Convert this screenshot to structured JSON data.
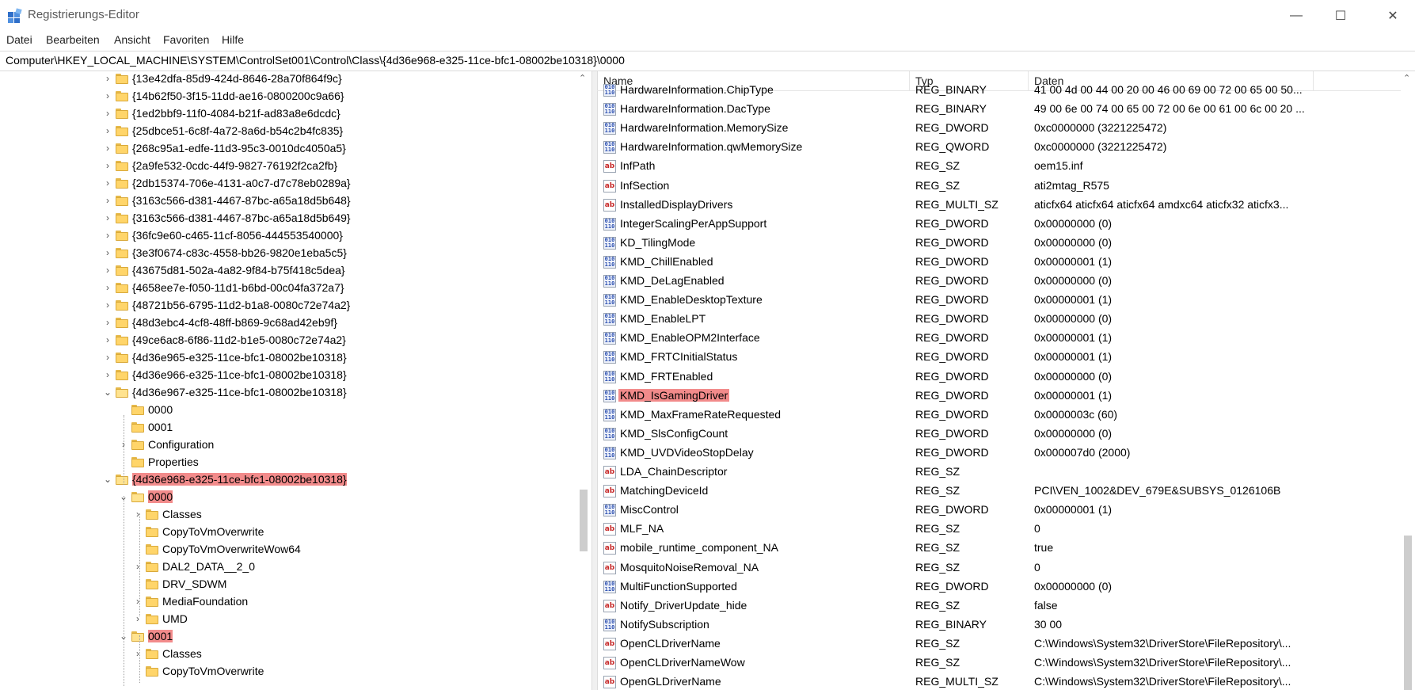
{
  "window": {
    "title": "Registrierungs-Editor",
    "controls": {
      "minimize": "—",
      "maximize": "☐",
      "close": "✕"
    }
  },
  "menu": [
    "Datei",
    "Bearbeiten",
    "Ansicht",
    "Favoriten",
    "Hilfe"
  ],
  "address": "Computer\\HKEY_LOCAL_MACHINE\\SYSTEM\\ControlSet001\\Control\\Class\\{4d36e968-e325-11ce-bfc1-08002be10318}\\0000",
  "tree": [
    {
      "label": "{13e42dfa-85d9-424d-8646-28a70f864f9c}",
      "depth": 0,
      "expander": "collapsed",
      "highlight": false
    },
    {
      "label": "{14b62f50-3f15-11dd-ae16-0800200c9a66}",
      "depth": 0,
      "expander": "collapsed",
      "highlight": false
    },
    {
      "label": "{1ed2bbf9-11f0-4084-b21f-ad83a8e6dcdc}",
      "depth": 0,
      "expander": "collapsed",
      "highlight": false
    },
    {
      "label": "{25dbce51-6c8f-4a72-8a6d-b54c2b4fc835}",
      "depth": 0,
      "expander": "collapsed",
      "highlight": false
    },
    {
      "label": "{268c95a1-edfe-11d3-95c3-0010dc4050a5}",
      "depth": 0,
      "expander": "collapsed",
      "highlight": false
    },
    {
      "label": "{2a9fe532-0cdc-44f9-9827-76192f2ca2fb}",
      "depth": 0,
      "expander": "collapsed",
      "highlight": false
    },
    {
      "label": "{2db15374-706e-4131-a0c7-d7c78eb0289a}",
      "depth": 0,
      "expander": "collapsed",
      "highlight": false
    },
    {
      "label": "{3163c566-d381-4467-87bc-a65a18d5b648}",
      "depth": 0,
      "expander": "collapsed",
      "highlight": false
    },
    {
      "label": "{3163c566-d381-4467-87bc-a65a18d5b649}",
      "depth": 0,
      "expander": "collapsed",
      "highlight": false
    },
    {
      "label": "{36fc9e60-c465-11cf-8056-444553540000}",
      "depth": 0,
      "expander": "collapsed",
      "highlight": false
    },
    {
      "label": "{3e3f0674-c83c-4558-bb26-9820e1eba5c5}",
      "depth": 0,
      "expander": "collapsed",
      "highlight": false
    },
    {
      "label": "{43675d81-502a-4a82-9f84-b75f418c5dea}",
      "depth": 0,
      "expander": "collapsed",
      "highlight": false
    },
    {
      "label": "{4658ee7e-f050-11d1-b6bd-00c04fa372a7}",
      "depth": 0,
      "expander": "collapsed",
      "highlight": false
    },
    {
      "label": "{48721b56-6795-11d2-b1a8-0080c72e74a2}",
      "depth": 0,
      "expander": "collapsed",
      "highlight": false
    },
    {
      "label": "{48d3ebc4-4cf8-48ff-b869-9c68ad42eb9f}",
      "depth": 0,
      "expander": "collapsed",
      "highlight": false
    },
    {
      "label": "{49ce6ac8-6f86-11d2-b1e5-0080c72e74a2}",
      "depth": 0,
      "expander": "collapsed",
      "highlight": false
    },
    {
      "label": "{4d36e965-e325-11ce-bfc1-08002be10318}",
      "depth": 0,
      "expander": "collapsed",
      "highlight": false
    },
    {
      "label": "{4d36e966-e325-11ce-bfc1-08002be10318}",
      "depth": 0,
      "expander": "collapsed",
      "highlight": false
    },
    {
      "label": "{4d36e967-e325-11ce-bfc1-08002be10318}",
      "depth": 0,
      "expander": "expanded",
      "highlight": false
    },
    {
      "label": "0000",
      "depth": 1,
      "expander": "none",
      "highlight": false
    },
    {
      "label": "0001",
      "depth": 1,
      "expander": "none",
      "highlight": false
    },
    {
      "label": "Configuration",
      "depth": 1,
      "expander": "collapsed",
      "highlight": false
    },
    {
      "label": "Properties",
      "depth": 1,
      "expander": "none",
      "highlight": false
    },
    {
      "label": "{4d36e968-e325-11ce-bfc1-08002be10318}",
      "depth": 0,
      "expander": "expanded",
      "highlight": true
    },
    {
      "label": "0000",
      "depth": 1,
      "expander": "expanded",
      "highlight": true
    },
    {
      "label": "Classes",
      "depth": 2,
      "expander": "collapsed",
      "highlight": false
    },
    {
      "label": "CopyToVmOverwrite",
      "depth": 2,
      "expander": "none",
      "highlight": false
    },
    {
      "label": "CopyToVmOverwriteWow64",
      "depth": 2,
      "expander": "none",
      "highlight": false
    },
    {
      "label": "DAL2_DATA__2_0",
      "depth": 2,
      "expander": "collapsed",
      "highlight": false
    },
    {
      "label": "DRV_SDWM",
      "depth": 2,
      "expander": "none",
      "highlight": false
    },
    {
      "label": "MediaFoundation",
      "depth": 2,
      "expander": "collapsed",
      "highlight": false
    },
    {
      "label": "UMD",
      "depth": 2,
      "expander": "collapsed",
      "highlight": false
    },
    {
      "label": "0001",
      "depth": 1,
      "expander": "expanded",
      "highlight": true
    },
    {
      "label": "Classes",
      "depth": 2,
      "expander": "collapsed",
      "highlight": false
    },
    {
      "label": "CopyToVmOverwrite",
      "depth": 2,
      "expander": "none",
      "highlight": false
    }
  ],
  "values_header": {
    "name": "Name",
    "type": "Typ",
    "data": "Daten"
  },
  "values": [
    {
      "name": "HardwareInformation.ChipType",
      "type": "REG_BINARY",
      "data": "41 00 4d 00 44 00 20 00 46 00 69 00 72 00 65 00 50...",
      "icon": "bin",
      "highlight": false
    },
    {
      "name": "HardwareInformation.DacType",
      "type": "REG_BINARY",
      "data": "49 00 6e 00 74 00 65 00 72 00 6e 00 61 00 6c 00 20 ...",
      "icon": "bin",
      "highlight": false
    },
    {
      "name": "HardwareInformation.MemorySize",
      "type": "REG_DWORD",
      "data": "0xc0000000 (3221225472)",
      "icon": "bin",
      "highlight": false
    },
    {
      "name": "HardwareInformation.qwMemorySize",
      "type": "REG_QWORD",
      "data": "0xc0000000 (3221225472)",
      "icon": "bin",
      "highlight": false
    },
    {
      "name": "InfPath",
      "type": "REG_SZ",
      "data": "oem15.inf",
      "icon": "sz",
      "highlight": false
    },
    {
      "name": "InfSection",
      "type": "REG_SZ",
      "data": "ati2mtag_R575",
      "icon": "sz",
      "highlight": false
    },
    {
      "name": "InstalledDisplayDrivers",
      "type": "REG_MULTI_SZ",
      "data": "aticfx64 aticfx64 aticfx64 amdxc64 aticfx32 aticfx3...",
      "icon": "sz",
      "highlight": false
    },
    {
      "name": "IntegerScalingPerAppSupport",
      "type": "REG_DWORD",
      "data": "0x00000000 (0)",
      "icon": "bin",
      "highlight": false
    },
    {
      "name": "KD_TilingMode",
      "type": "REG_DWORD",
      "data": "0x00000000 (0)",
      "icon": "bin",
      "highlight": false
    },
    {
      "name": "KMD_ChillEnabled",
      "type": "REG_DWORD",
      "data": "0x00000001 (1)",
      "icon": "bin",
      "highlight": false
    },
    {
      "name": "KMD_DeLagEnabled",
      "type": "REG_DWORD",
      "data": "0x00000000 (0)",
      "icon": "bin",
      "highlight": false
    },
    {
      "name": "KMD_EnableDesktopTexture",
      "type": "REG_DWORD",
      "data": "0x00000001 (1)",
      "icon": "bin",
      "highlight": false
    },
    {
      "name": "KMD_EnableLPT",
      "type": "REG_DWORD",
      "data": "0x00000000 (0)",
      "icon": "bin",
      "highlight": false
    },
    {
      "name": "KMD_EnableOPM2Interface",
      "type": "REG_DWORD",
      "data": "0x00000001 (1)",
      "icon": "bin",
      "highlight": false
    },
    {
      "name": "KMD_FRTCInitialStatus",
      "type": "REG_DWORD",
      "data": "0x00000001 (1)",
      "icon": "bin",
      "highlight": false
    },
    {
      "name": "KMD_FRTEnabled",
      "type": "REG_DWORD",
      "data": "0x00000000 (0)",
      "icon": "bin",
      "highlight": false
    },
    {
      "name": "KMD_IsGamingDriver",
      "type": "REG_DWORD",
      "data": "0x00000001 (1)",
      "icon": "bin",
      "highlight": true
    },
    {
      "name": "KMD_MaxFrameRateRequested",
      "type": "REG_DWORD",
      "data": "0x0000003c (60)",
      "icon": "bin",
      "highlight": false
    },
    {
      "name": "KMD_SlsConfigCount",
      "type": "REG_DWORD",
      "data": "0x00000000 (0)",
      "icon": "bin",
      "highlight": false
    },
    {
      "name": "KMD_UVDVideoStopDelay",
      "type": "REG_DWORD",
      "data": "0x000007d0 (2000)",
      "icon": "bin",
      "highlight": false
    },
    {
      "name": "LDA_ChainDescriptor",
      "type": "REG_SZ",
      "data": "",
      "icon": "sz",
      "highlight": false
    },
    {
      "name": "MatchingDeviceId",
      "type": "REG_SZ",
      "data": "PCI\\VEN_1002&DEV_679E&SUBSYS_0126106B",
      "icon": "sz",
      "highlight": false
    },
    {
      "name": "MiscControl",
      "type": "REG_DWORD",
      "data": "0x00000001 (1)",
      "icon": "bin",
      "highlight": false
    },
    {
      "name": "MLF_NA",
      "type": "REG_SZ",
      "data": "0",
      "icon": "sz",
      "highlight": false
    },
    {
      "name": "mobile_runtime_component_NA",
      "type": "REG_SZ",
      "data": "true",
      "icon": "sz",
      "highlight": false
    },
    {
      "name": "MosquitoNoiseRemoval_NA",
      "type": "REG_SZ",
      "data": "0",
      "icon": "sz",
      "highlight": false
    },
    {
      "name": "MultiFunctionSupported",
      "type": "REG_DWORD",
      "data": "0x00000000 (0)",
      "icon": "bin",
      "highlight": false
    },
    {
      "name": "Notify_DriverUpdate_hide",
      "type": "REG_SZ",
      "data": "false",
      "icon": "sz",
      "highlight": false
    },
    {
      "name": "NotifySubscription",
      "type": "REG_BINARY",
      "data": "30 00",
      "icon": "bin",
      "highlight": false
    },
    {
      "name": "OpenCLDriverName",
      "type": "REG_SZ",
      "data": "C:\\Windows\\System32\\DriverStore\\FileRepository\\...",
      "icon": "sz",
      "highlight": false
    },
    {
      "name": "OpenCLDriverNameWow",
      "type": "REG_SZ",
      "data": "C:\\Windows\\System32\\DriverStore\\FileRepository\\...",
      "icon": "sz",
      "highlight": false
    },
    {
      "name": "OpenGLDriverName",
      "type": "REG_MULTI_SZ",
      "data": "C:\\Windows\\System32\\DriverStore\\FileRepository\\...",
      "icon": "sz",
      "highlight": false
    }
  ],
  "icons": {
    "string_value": "ab",
    "binary_value": "010 110"
  },
  "colors": {
    "highlight": "#f28b8b",
    "folder": "#ffd56a"
  }
}
